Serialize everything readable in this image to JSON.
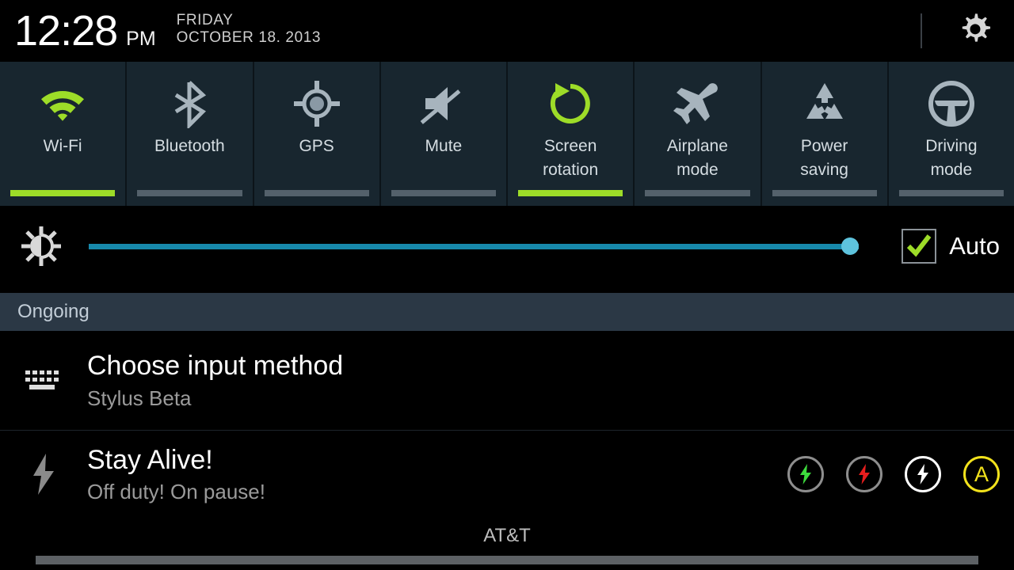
{
  "statusbar": {
    "time": "12:28",
    "ampm": "PM",
    "weekday": "FRIDAY",
    "date": "OCTOBER 18. 2013",
    "settings_icon": "gear-icon"
  },
  "quick_settings": {
    "toggles": [
      {
        "label": "Wi-Fi",
        "icon": "wifi-icon",
        "active": true
      },
      {
        "label": "Bluetooth",
        "icon": "bluetooth-icon",
        "active": false
      },
      {
        "label": "GPS",
        "icon": "gps-crosshair-icon",
        "active": false
      },
      {
        "label": "Mute",
        "icon": "mute-speaker-icon",
        "active": false
      },
      {
        "label": "Screen\nrotation",
        "icon": "rotate-icon",
        "active": true
      },
      {
        "label": "Airplane\nmode",
        "icon": "airplane-icon",
        "active": false
      },
      {
        "label": "Power\nsaving",
        "icon": "recycle-icon",
        "active": false
      },
      {
        "label": "Driving\nmode",
        "icon": "steering-wheel-icon",
        "active": false
      }
    ],
    "active_color": "#9ddc28",
    "inactive_color": "#54616b",
    "panel_bg": "#18262f"
  },
  "brightness": {
    "icon": "brightness-sun-icon",
    "value_percent": 100,
    "track_color": "#1789ab",
    "thumb_color": "#5ec3dd",
    "auto_label": "Auto",
    "auto_checked": true,
    "check_color": "#9ddc28"
  },
  "sections": {
    "ongoing_label": "Ongoing",
    "ongoing_bg": "#2b3845"
  },
  "notifications": [
    {
      "id": "choose-input-method",
      "icon": "keyboard-icon",
      "title": "Choose input method",
      "subtitle": "Stylus Beta"
    },
    {
      "id": "stay-alive",
      "icon": "lightning-bolt-icon",
      "title": "Stay Alive!",
      "subtitle": "Off duty! On pause!",
      "actions": [
        {
          "name": "bolt-green-button",
          "glyph": "bolt",
          "glyph_color": "#3ddc3d",
          "ring_color": "#8e8e8e"
        },
        {
          "name": "bolt-red-button",
          "glyph": "bolt",
          "glyph_color": "#e81e1e",
          "ring_color": "#8e8e8e"
        },
        {
          "name": "bolt-white-button",
          "glyph": "bolt",
          "glyph_color": "#ffffff",
          "ring_color": "#ffffff"
        },
        {
          "name": "auto-mode-button",
          "glyph": "A",
          "glyph_color": "#f2e21c",
          "ring_color": "#f2e21c"
        }
      ]
    }
  ],
  "footer": {
    "carrier": "AT&T",
    "handle": "drag-handle"
  }
}
